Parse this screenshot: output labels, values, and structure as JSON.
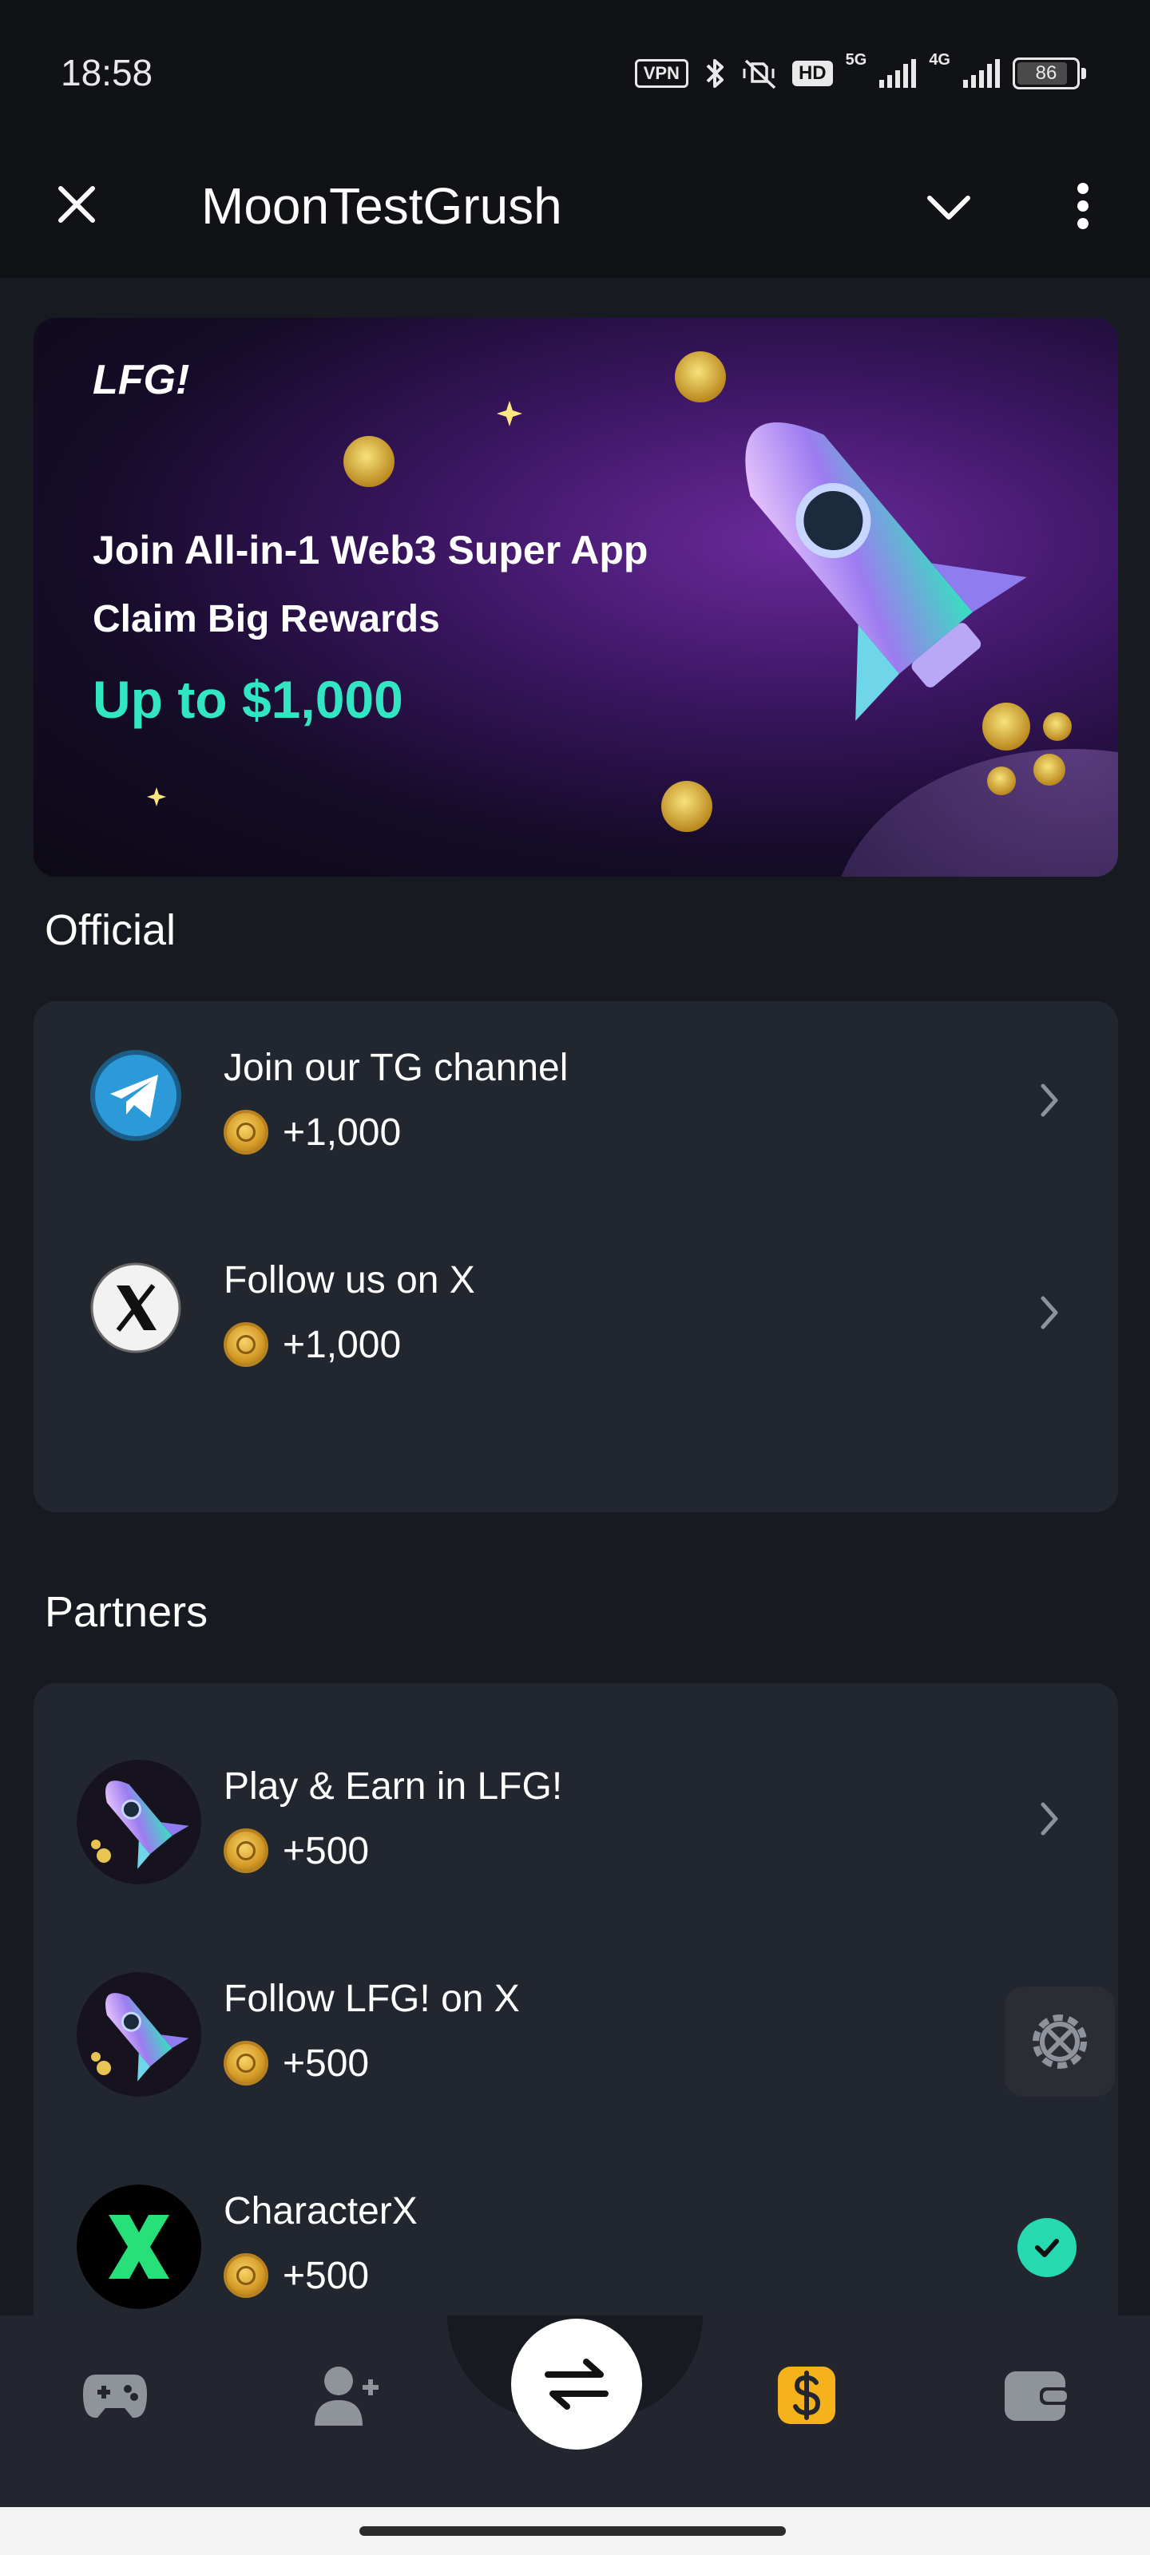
{
  "status_bar": {
    "time": "18:58",
    "vpn": "VPN",
    "hd": "HD",
    "net_5g": "5G",
    "net_4g": "4G",
    "battery": "86"
  },
  "header": {
    "title": "MoonTestGrush"
  },
  "banner": {
    "brand": "LFG!",
    "line1": "Join All-in-1 Web3 Super App",
    "line2": "Claim Big Rewards",
    "line3": "Up to $1,000"
  },
  "official": {
    "title": "Official",
    "items": [
      {
        "label": "Join our TG channel",
        "reward": "+1,000"
      },
      {
        "label": "Follow us on X",
        "reward": "+1,000"
      }
    ]
  },
  "partners": {
    "title": "Partners",
    "items": [
      {
        "label": "Play & Earn in LFG!",
        "reward": "+500"
      },
      {
        "label": "Follow LFG! on X",
        "reward": "+500"
      },
      {
        "label": "CharacterX",
        "reward": "+500"
      }
    ]
  },
  "colors": {
    "accent": "#33e6c3",
    "check": "#26d9b0",
    "earn_nav": "#f5b21a"
  },
  "icons": {
    "nav": [
      "gamepad-icon",
      "add-friend-icon",
      "swap-icon",
      "earn-dollar-icon",
      "wallet-icon"
    ]
  }
}
